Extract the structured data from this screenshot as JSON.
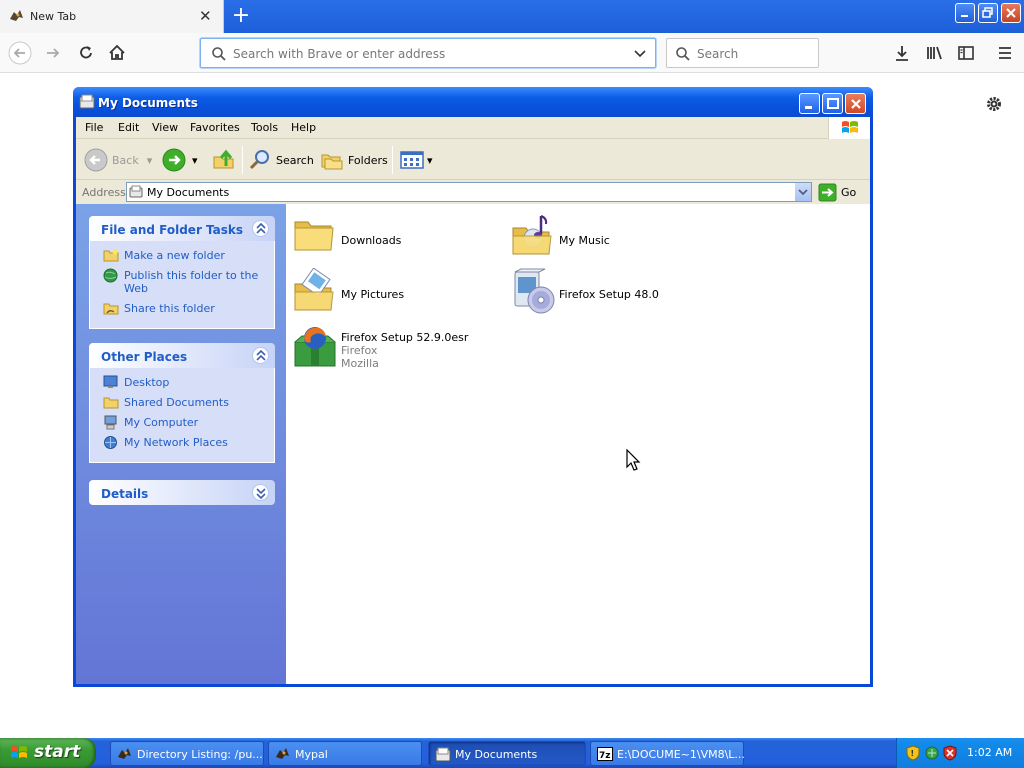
{
  "browser": {
    "tab_title": "New Tab",
    "url_placeholder": "Search with Brave or enter address",
    "search_placeholder": "Search"
  },
  "window": {
    "title": "My Documents",
    "menu": [
      "File",
      "Edit",
      "View",
      "Favorites",
      "Tools",
      "Help"
    ],
    "toolbar": {
      "back": "Back",
      "search": "Search",
      "folders": "Folders"
    },
    "address": {
      "label": "Address",
      "value": "My Documents",
      "go": "Go"
    },
    "tasks_panel": {
      "title": "File and Folder Tasks",
      "links": [
        "Make a new folder",
        "Publish this folder to the Web",
        "Share this folder"
      ]
    },
    "other_places": {
      "title": "Other Places",
      "links": [
        "Desktop",
        "Shared Documents",
        "My Computer",
        "My Network Places"
      ]
    },
    "details": {
      "title": "Details"
    },
    "files": [
      {
        "name": "Downloads",
        "icon": "folder-icon"
      },
      {
        "name": "My Music",
        "icon": "music-folder-icon"
      },
      {
        "name": "My Pictures",
        "icon": "pictures-folder-icon"
      },
      {
        "name": "Firefox Setup 48.0",
        "icon": "installer-cd-icon"
      },
      {
        "name": "Firefox Setup 52.9.0esr",
        "sub1": "Firefox",
        "sub2": "Mozilla",
        "icon": "firefox-installer-icon"
      }
    ]
  },
  "taskbar": {
    "start": "start",
    "tasks": [
      {
        "title": "Directory Listing: /pu..."
      },
      {
        "title": "Mypal"
      },
      {
        "title": "My Documents"
      },
      {
        "title": "E:\\DOCUME~1\\VM8\\L..."
      }
    ],
    "clock": "1:02 AM"
  },
  "colors": {
    "xp_title_blue": "#0a4ccf",
    "task_pane_blue": "#7ba2e7",
    "link_blue": "#215dc6",
    "start_green": "#3a9b35"
  }
}
